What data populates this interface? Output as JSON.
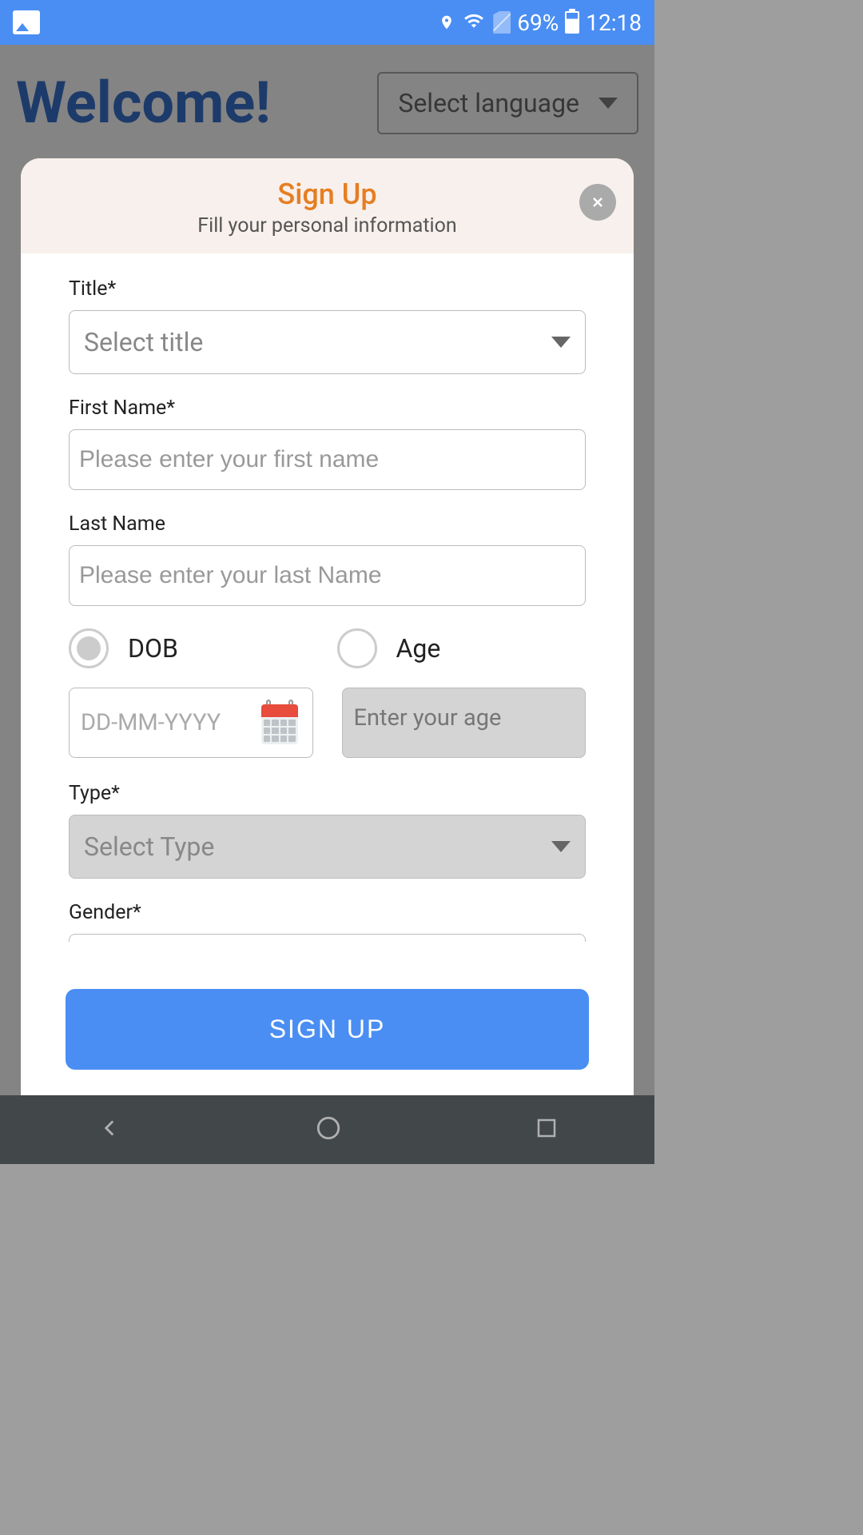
{
  "status": {
    "battery_percent": "69%",
    "time": "12:18"
  },
  "background": {
    "welcome": "Welcome!",
    "language_select": "Select language"
  },
  "modal": {
    "title": "Sign Up",
    "subtitle": "Fill your personal information",
    "fields": {
      "title_label": "Title*",
      "title_placeholder": "Select title",
      "first_name_label": "First Name*",
      "first_name_placeholder": "Please enter your first name",
      "last_name_label": "Last Name",
      "last_name_placeholder": "Please enter your last Name",
      "dob_label": "DOB",
      "age_label": "Age",
      "dob_placeholder": "DD-MM-YYYY",
      "age_placeholder": "Enter your age",
      "type_label": "Type*",
      "type_placeholder": "Select Type",
      "gender_label": "Gender*"
    },
    "submit_button": "SIGN UP"
  }
}
